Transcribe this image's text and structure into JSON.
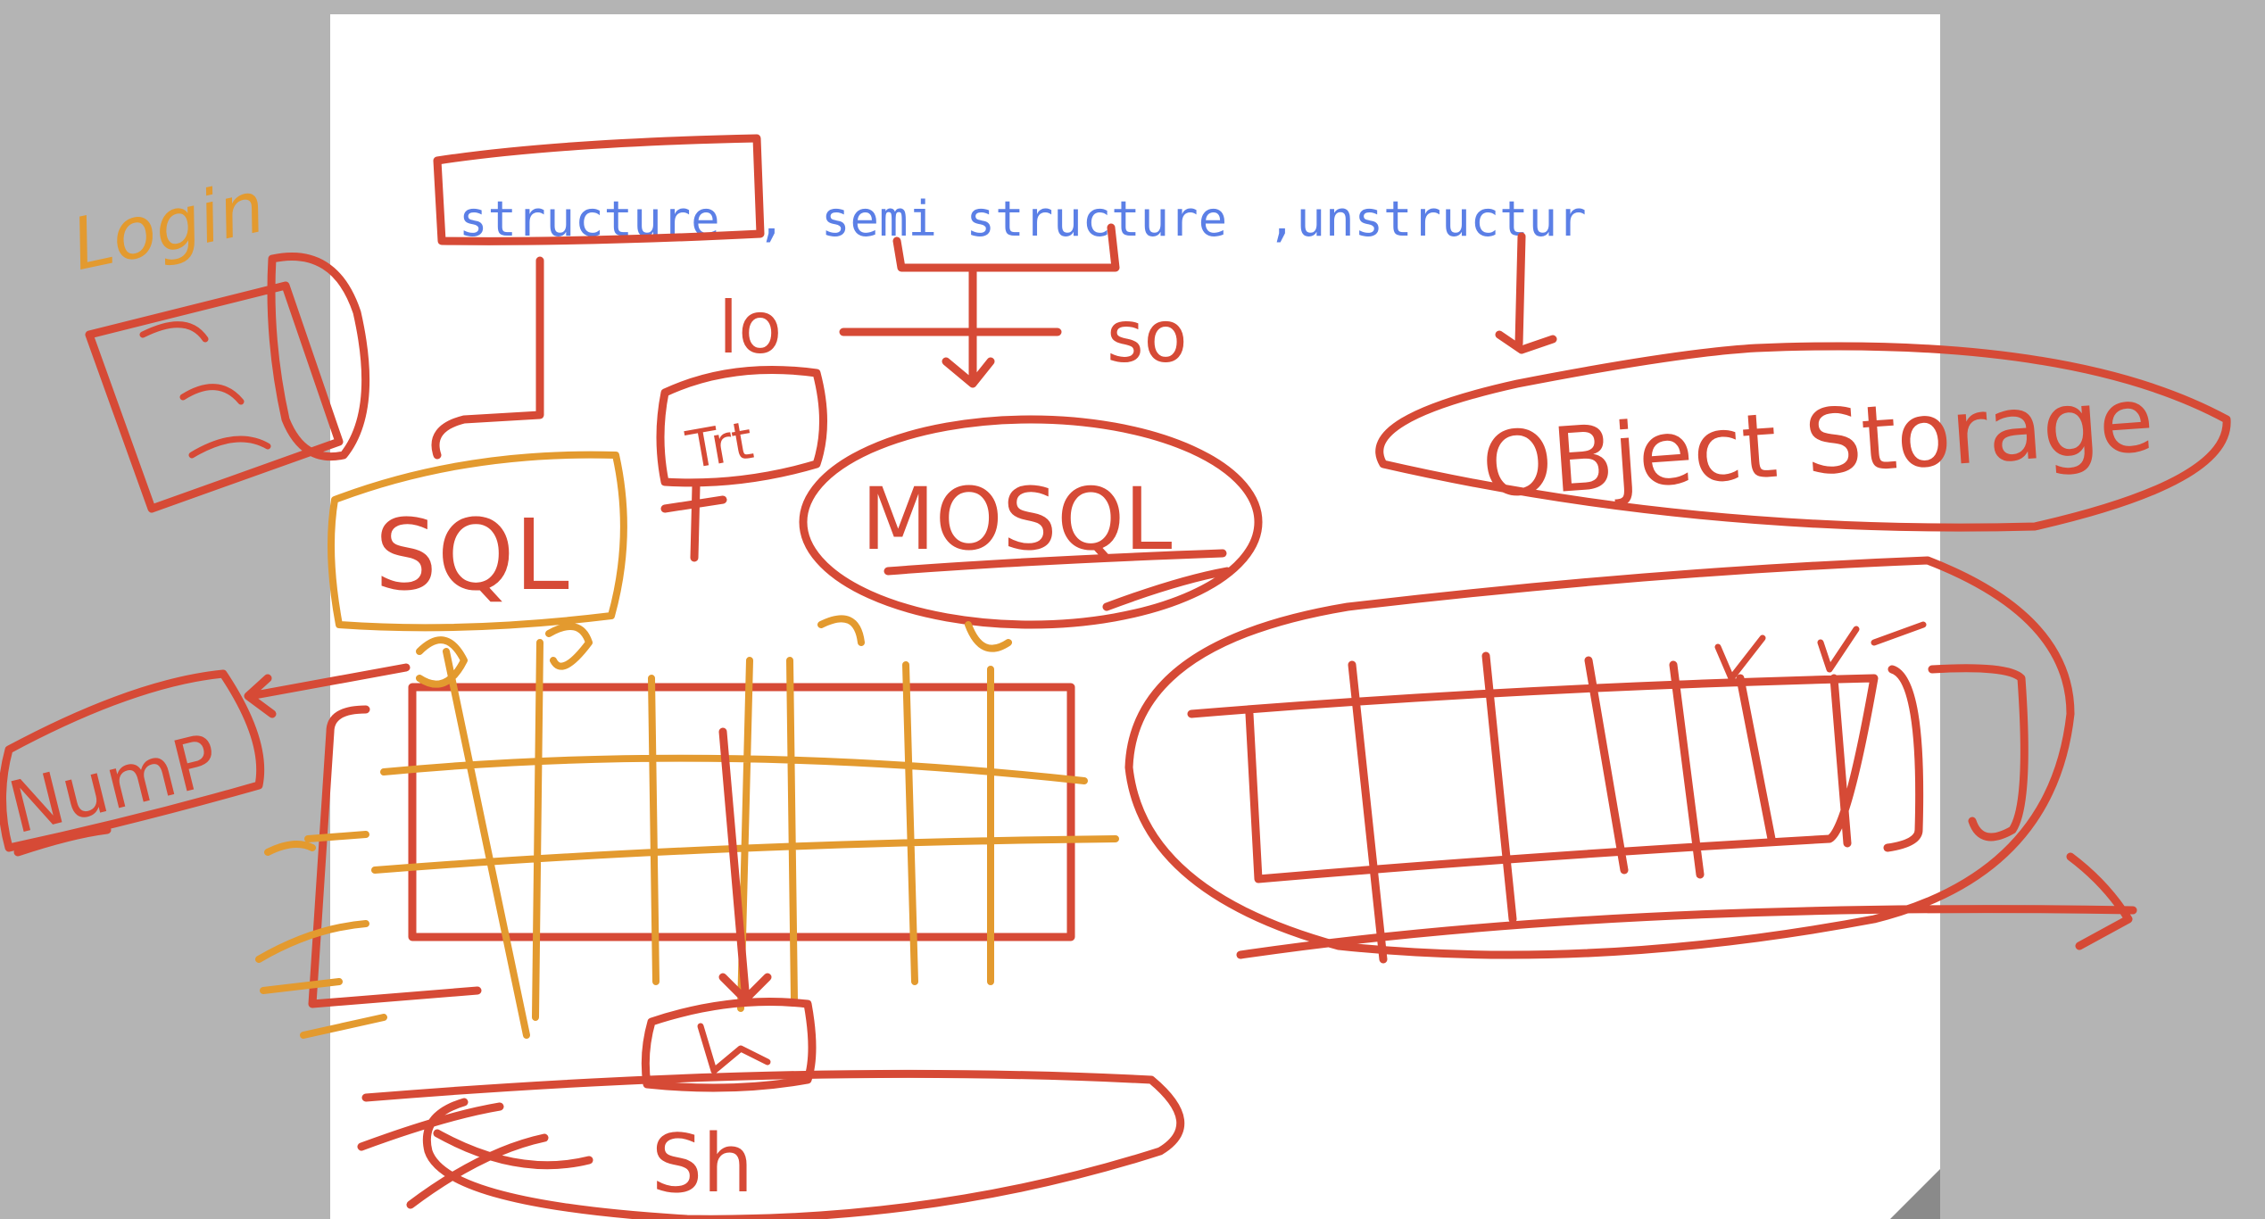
{
  "typed_text": {
    "structure": "structure",
    "comma1": ",",
    "semi": "semi structure",
    "unstructured": ",unstructur"
  },
  "handwriting": {
    "login": "Login",
    "nump": "NumP",
    "sql": "SQL",
    "mosql": "MOSQL",
    "object_storage": "OBject Storage",
    "lo": "lo",
    "so": "so",
    "tra": "Trt",
    "sh": "Sh"
  },
  "colors": {
    "typed_text": "#5b7fe6",
    "ink_red": "#d64a36",
    "ink_orange": "#e39a2f",
    "background": "#b4b4b4",
    "page": "#ffffff"
  }
}
